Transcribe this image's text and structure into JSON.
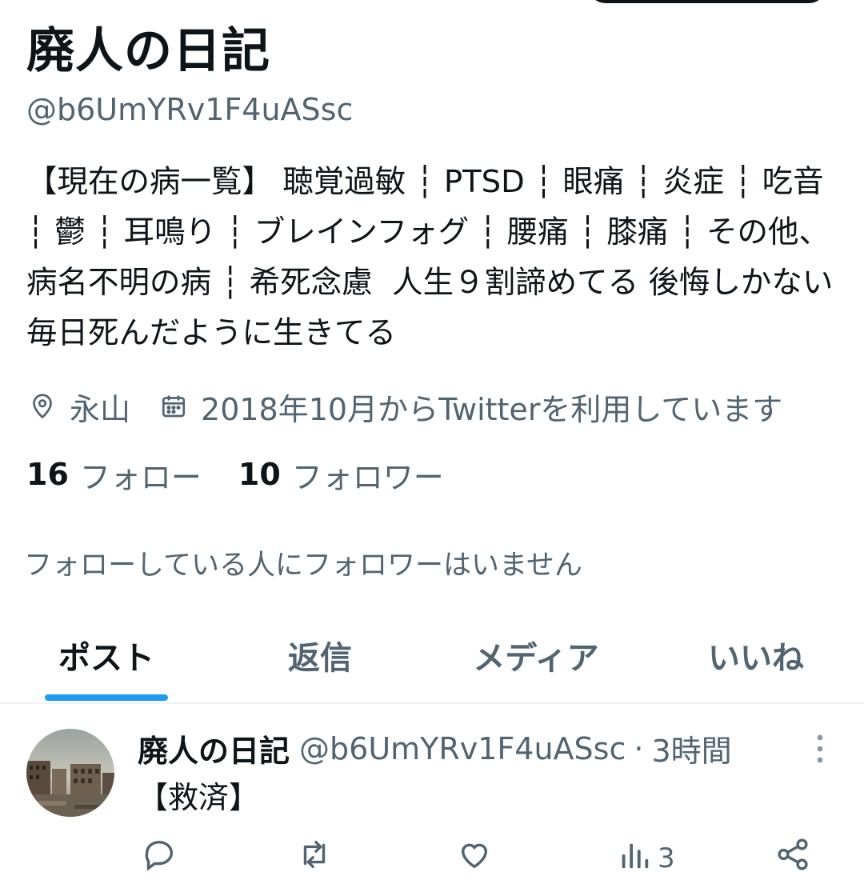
{
  "profile": {
    "display_name": "廃人の日記",
    "handle": "@b6UmYRv1F4uASsc",
    "bio": "【現在の病一覧】 聴覚過敏 ┆ PTSD ┆ 眼痛 ┆ 炎症 ┆ 吃音 ┆ 鬱 ┆ 耳鳴り ┆ ブレインフォグ ┆ 腰痛 ┆ 膝痛 ┆ その他、病名不明の病 ┆ 希死念慮  人生９割諦めてる 後悔しかない 毎日死んだように生きてる",
    "location": "永山",
    "joined": "2018年10月からTwitterを利用しています",
    "following_count": "16",
    "following_label": "フォロー",
    "followers_count": "10",
    "followers_label": "フォロワー",
    "known_followers": "フォローしている人にフォロワーはいません"
  },
  "icons": {
    "location": "location-pin-icon",
    "calendar": "calendar-icon"
  },
  "tabs": [
    {
      "label": "ポスト",
      "active": true
    },
    {
      "label": "返信",
      "active": false
    },
    {
      "label": "メディア",
      "active": false
    },
    {
      "label": "いいね",
      "active": false
    }
  ],
  "post": {
    "author_name": "廃人の日記",
    "author_handle": "@b6UmYRv1F4uASsc",
    "separator": "·",
    "time": "3時間",
    "text": "【救済】",
    "views": "3"
  },
  "colors": {
    "accent": "#1d9bf0",
    "text_primary": "#0f1419",
    "text_secondary": "#536471",
    "divider": "#eff3f4"
  }
}
